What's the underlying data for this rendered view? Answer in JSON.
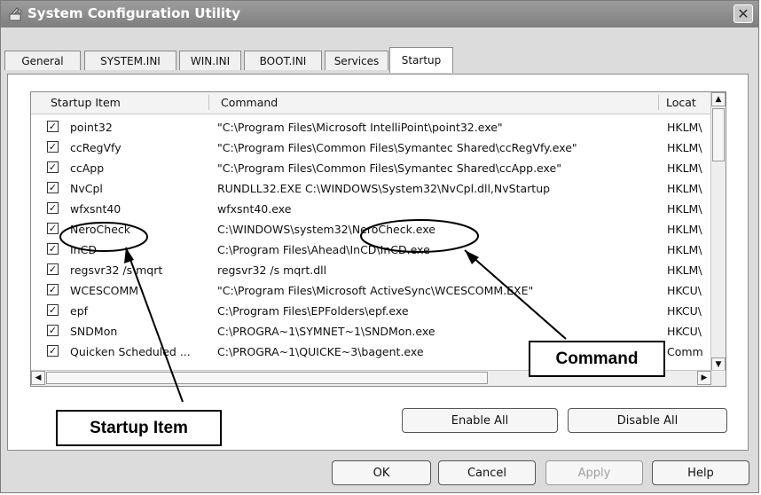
{
  "window": {
    "title": "System Configuration Utility",
    "close_symbol": "✕"
  },
  "tabs": [
    {
      "label": "General"
    },
    {
      "label": "SYSTEM.INI"
    },
    {
      "label": "WIN.INI"
    },
    {
      "label": "BOOT.INI"
    },
    {
      "label": "Services"
    },
    {
      "label": "Startup",
      "active": true
    }
  ],
  "list": {
    "columns": [
      "Startup Item",
      "Command",
      "Locat"
    ],
    "rows": [
      {
        "checked": true,
        "item": "point32",
        "command": "\"C:\\Program Files\\Microsoft IntelliPoint\\point32.exe\"",
        "location": "HKLM\\"
      },
      {
        "checked": true,
        "item": "ccRegVfy",
        "command": "\"C:\\Program Files\\Common Files\\Symantec Shared\\ccRegVfy.exe\"",
        "location": "HKLM\\"
      },
      {
        "checked": true,
        "item": "ccApp",
        "command": "\"C:\\Program Files\\Common Files\\Symantec Shared\\ccApp.exe\"",
        "location": "HKLM\\"
      },
      {
        "checked": true,
        "item": "NvCpl",
        "command": "RUNDLL32.EXE C:\\WINDOWS\\System32\\NvCpl.dll,NvStartup",
        "location": "HKLM\\"
      },
      {
        "checked": true,
        "item": "wfxsnt40",
        "command": "wfxsnt40.exe",
        "location": "HKLM\\"
      },
      {
        "checked": true,
        "item": "NeroCheck",
        "command": "C:\\WINDOWS\\system32\\NeroCheck.exe",
        "location": "HKLM\\"
      },
      {
        "checked": true,
        "item": "InCD",
        "command": "C:\\Program Files\\Ahead\\InCD\\InCD.exe",
        "location": "HKLM\\"
      },
      {
        "checked": true,
        "item": "regsvr32 /s mqrt",
        "command": "regsvr32 /s mqrt.dll",
        "location": "HKLM\\"
      },
      {
        "checked": true,
        "item": "WCESCOMM",
        "command": "\"C:\\Program Files\\Microsoft ActiveSync\\WCESCOMM.EXE\"",
        "location": "HKCU\\"
      },
      {
        "checked": true,
        "item": "epf",
        "command": "C:\\Program Files\\EPFolders\\epf.exe",
        "location": "HKCU\\"
      },
      {
        "checked": true,
        "item": "SNDMon",
        "command": "C:\\PROGRA~1\\SYMNET~1\\SNDMon.exe",
        "location": "HKCU\\"
      },
      {
        "checked": true,
        "item": "Quicken Scheduled ...",
        "command": "C:\\PROGRA~1\\QUICKE~3\\bagent.exe",
        "location": "Comm"
      }
    ]
  },
  "scroll": {
    "up": "▲",
    "down": "▼",
    "left": "◀",
    "right": "▶",
    "check": "✓"
  },
  "buttons": {
    "enable_all": "Enable All",
    "disable_all": "Disable All",
    "ok": "OK",
    "cancel": "Cancel",
    "apply": "Apply",
    "help": "Help"
  },
  "callouts": {
    "startup_item": "Startup Item",
    "command": "Command"
  }
}
